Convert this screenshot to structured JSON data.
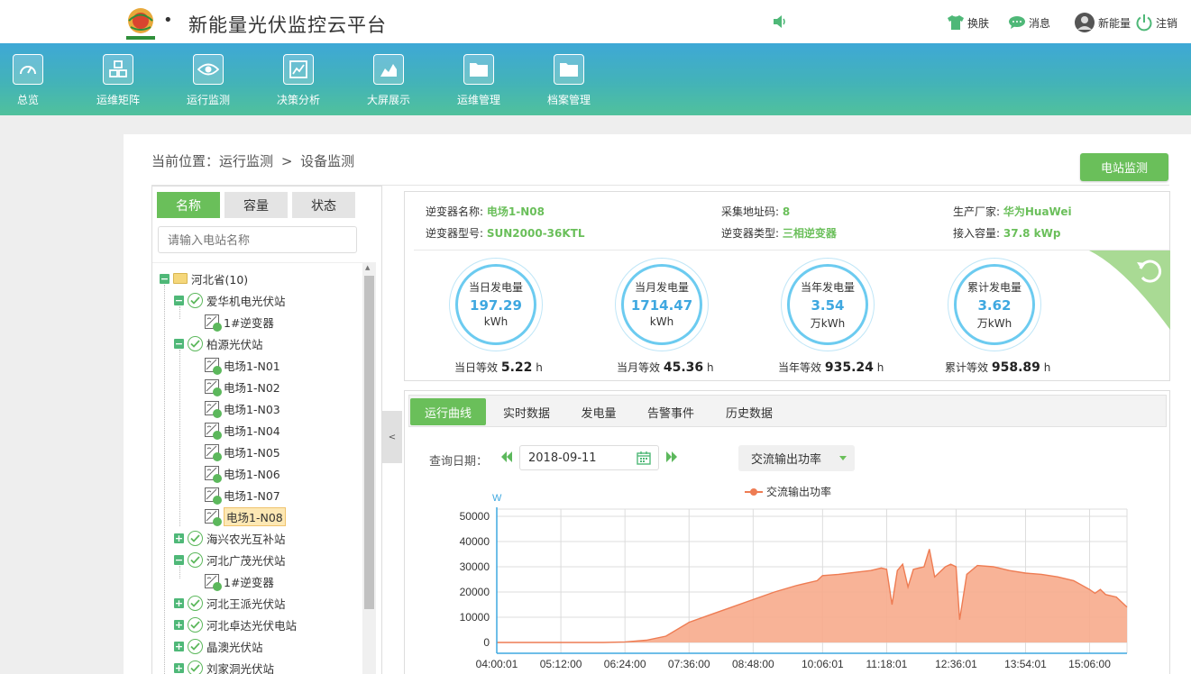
{
  "app": {
    "title": "新能量光伏监控云平台",
    "dot": "•"
  },
  "topbar": {
    "skin": "换肤",
    "messages": "消息",
    "user": "新能量",
    "logout": "注销"
  },
  "nav": [
    {
      "label": "总览",
      "icon": "gauge-icon"
    },
    {
      "label": "运维矩阵",
      "icon": "cubes-icon"
    },
    {
      "label": "运行监测",
      "icon": "eye-icon"
    },
    {
      "label": "决策分析",
      "icon": "chart-icon"
    },
    {
      "label": "大屏展示",
      "icon": "area-chart-icon"
    },
    {
      "label": "运维管理",
      "icon": "folder-icon"
    },
    {
      "label": "档案管理",
      "icon": "folder-icon"
    }
  ],
  "breadcrumb": {
    "prefix": "当前位置：",
    "level1": "运行监测",
    "sep": ">",
    "level2": "设备监测"
  },
  "station_button": "电站监测",
  "left_tabs": [
    "名称",
    "容量",
    "状态"
  ],
  "search_placeholder": "请输入电站名称",
  "collapse_label": "<",
  "tree": [
    {
      "label": "河北省(10)",
      "level": 0,
      "kind": "province"
    },
    {
      "label": "爱华机电光伏站",
      "level": 1,
      "kind": "station"
    },
    {
      "label": "1#逆变器",
      "level": 2,
      "kind": "inverter"
    },
    {
      "label": "柏源光伏站",
      "level": 1,
      "kind": "station"
    },
    {
      "label": "电场1-N01",
      "level": 2,
      "kind": "inverter"
    },
    {
      "label": "电场1-N02",
      "level": 2,
      "kind": "inverter"
    },
    {
      "label": "电场1-N03",
      "level": 2,
      "kind": "inverter"
    },
    {
      "label": "电场1-N04",
      "level": 2,
      "kind": "inverter"
    },
    {
      "label": "电场1-N05",
      "level": 2,
      "kind": "inverter"
    },
    {
      "label": "电场1-N06",
      "level": 2,
      "kind": "inverter"
    },
    {
      "label": "电场1-N07",
      "level": 2,
      "kind": "inverter"
    },
    {
      "label": "电场1-N08",
      "level": 2,
      "kind": "inverter",
      "selected": true
    },
    {
      "label": "海兴农光互补站",
      "level": 1,
      "kind": "station-collapsed"
    },
    {
      "label": "河北广茂光伏站",
      "level": 1,
      "kind": "station"
    },
    {
      "label": "1#逆变器",
      "level": 2,
      "kind": "inverter"
    },
    {
      "label": "河北王派光伏站",
      "level": 1,
      "kind": "station-collapsed"
    },
    {
      "label": "河北卓达光伏电站",
      "level": 1,
      "kind": "station-collapsed"
    },
    {
      "label": "晶澳光伏站",
      "level": 1,
      "kind": "station-collapsed"
    },
    {
      "label": "刘家洞光伏站",
      "level": 1,
      "kind": "station-collapsed"
    }
  ],
  "inverter": {
    "name_label": "逆变器名称:",
    "name": "电场1-N08",
    "addr_label": "采集地址码:",
    "addr": "8",
    "maker_label": "生产厂家:",
    "maker": "华为HuaWei",
    "model_label": "逆变器型号:",
    "model": "SUN2000-36KTL",
    "type_label": "逆变器类型:",
    "type": "三相逆变器",
    "capacity_label": "接入容量:",
    "capacity": "37.8 kWp"
  },
  "gauges": [
    {
      "label": "当日发电量",
      "value": "197.29",
      "unit": "kWh",
      "eq_label": "当日等效",
      "eq_value": "5.22",
      "eq_unit": "h"
    },
    {
      "label": "当月发电量",
      "value": "1714.47",
      "unit": "kWh",
      "eq_label": "当月等效",
      "eq_value": "45.36",
      "eq_unit": "h"
    },
    {
      "label": "当年发电量",
      "value": "3.54",
      "unit": "万kWh",
      "eq_label": "当年等效",
      "eq_value": "935.24",
      "eq_unit": "h"
    },
    {
      "label": "累计发电量",
      "value": "3.62",
      "unit": "万kWh",
      "eq_label": "累计等效",
      "eq_value": "958.89",
      "eq_unit": "h"
    }
  ],
  "chart_tabs": [
    "运行曲线",
    "实时数据",
    "发电量",
    "告警事件",
    "历史数据"
  ],
  "query": {
    "label": "查询日期：",
    "date": "2018-09-11",
    "metric": "交流输出功率"
  },
  "colors": {
    "accent": "#6abf5a",
    "series_line": "#ee7c53",
    "series_fill": "#f7ab8c",
    "gauge": "#6ccbf0",
    "gauge_value": "#3fa8e0"
  },
  "chart_data": {
    "type": "area",
    "title": "",
    "xlabel": "",
    "ylabel": "W",
    "legend": "交流输出功率",
    "legend_position": "top-center",
    "grid": true,
    "ylim": [
      0,
      50000
    ],
    "yticks": [
      0,
      10000,
      20000,
      30000,
      40000,
      50000
    ],
    "xticks": [
      "04:00:01",
      "05:12:00",
      "06:24:00",
      "07:36:00",
      "08:48:00",
      "10:06:01",
      "11:18:01",
      "12:36:01",
      "13:54:01",
      "15:06:00"
    ],
    "x_unit": "time",
    "series": [
      {
        "name": "交流输出功率",
        "points": [
          [
            "04:00",
            0
          ],
          [
            "05:00",
            0
          ],
          [
            "06:00",
            0
          ],
          [
            "06:24",
            200
          ],
          [
            "06:48",
            900
          ],
          [
            "07:10",
            2500
          ],
          [
            "07:36",
            8000
          ],
          [
            "08:00",
            11000
          ],
          [
            "08:24",
            14000
          ],
          [
            "08:48",
            17000
          ],
          [
            "09:12",
            20000
          ],
          [
            "09:36",
            22500
          ],
          [
            "10:00",
            24500
          ],
          [
            "10:06",
            26500
          ],
          [
            "10:24",
            27000
          ],
          [
            "10:48",
            28000
          ],
          [
            "11:00",
            28500
          ],
          [
            "11:12",
            29500
          ],
          [
            "11:18",
            29000
          ],
          [
            "11:24",
            15000
          ],
          [
            "11:30",
            28500
          ],
          [
            "11:36",
            31000
          ],
          [
            "11:42",
            22000
          ],
          [
            "11:48",
            29000
          ],
          [
            "12:00",
            30000
          ],
          [
            "12:06",
            37000
          ],
          [
            "12:12",
            26000
          ],
          [
            "12:24",
            30000
          ],
          [
            "12:30",
            31000
          ],
          [
            "12:36",
            30000
          ],
          [
            "12:40",
            9000
          ],
          [
            "12:48",
            27000
          ],
          [
            "13:00",
            30500
          ],
          [
            "13:18",
            30000
          ],
          [
            "13:36",
            28500
          ],
          [
            "13:54",
            27500
          ],
          [
            "14:12",
            27000
          ],
          [
            "14:30",
            26000
          ],
          [
            "14:48",
            24500
          ],
          [
            "15:06",
            21000
          ],
          [
            "15:12",
            19500
          ],
          [
            "15:18",
            21000
          ],
          [
            "15:24",
            19000
          ],
          [
            "15:36",
            18000
          ],
          [
            "15:48",
            14000
          ]
        ]
      }
    ]
  }
}
